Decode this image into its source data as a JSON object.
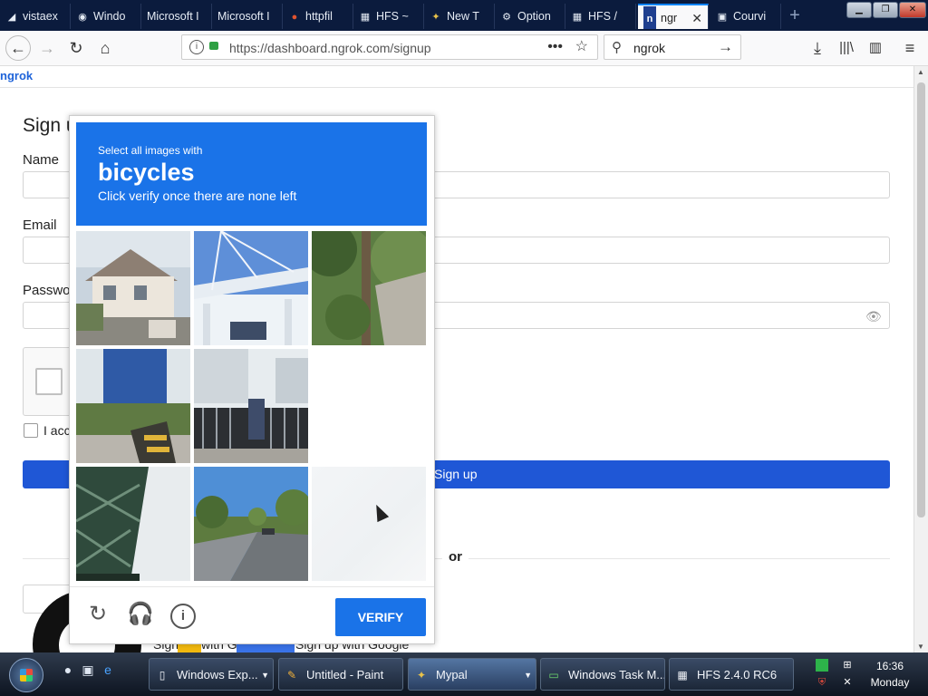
{
  "tabs": [
    {
      "label": "vistaex",
      "icon": "◢"
    },
    {
      "label": "Windo",
      "icon": "◉"
    },
    {
      "label": "Microsoft I",
      "icon": ""
    },
    {
      "label": "Microsoft I",
      "icon": ""
    },
    {
      "label": "httpfil",
      "icon": "●"
    },
    {
      "label": "HFS ~",
      "icon": "▦"
    },
    {
      "label": "New T",
      "icon": "✦"
    },
    {
      "label": "Option",
      "icon": "⚙"
    },
    {
      "label": "HFS /",
      "icon": "▦"
    },
    {
      "label": "ngr",
      "icon": "n"
    },
    {
      "label": "Courvi",
      "icon": "▣"
    }
  ],
  "browser": {
    "url": "https://dashboard.ngrok.com/signup",
    "search_value": "ngrok"
  },
  "page": {
    "brand": "ngrok",
    "heading": "Sign u",
    "name_label": "Name",
    "email_label": "Email",
    "password_label": "Passwor",
    "terms_label": "I acc",
    "signup_button": "Sign up",
    "or_text": "or",
    "github_partial": "Sign",
    "github_partial2": "with G",
    "google_button": "Sign up with Google"
  },
  "captcha": {
    "instruction_1": "Select all images with",
    "instruction_2": "bicycles",
    "instruction_3": "Click verify once there are none left",
    "verify_button": "VERIFY",
    "tiles": [
      {
        "state": "image",
        "subject": "house"
      },
      {
        "state": "image",
        "subject": "bridge"
      },
      {
        "state": "image",
        "subject": "trees"
      },
      {
        "state": "image",
        "subject": "fence"
      },
      {
        "state": "image",
        "subject": "gate"
      },
      {
        "state": "empty",
        "subject": ""
      },
      {
        "state": "image",
        "subject": "bridge-underside"
      },
      {
        "state": "image",
        "subject": "road"
      },
      {
        "state": "faded",
        "subject": ""
      }
    ]
  },
  "taskbar": {
    "buttons": [
      {
        "label": "Windows Exp...",
        "icon": "▯",
        "dropdown": true
      },
      {
        "label": "Untitled - Paint",
        "icon": "✎",
        "dropdown": false
      },
      {
        "label": "Mypal",
        "icon": "✦",
        "dropdown": true,
        "active": true
      },
      {
        "label": "Windows Task M...",
        "icon": "▭",
        "dropdown": false
      },
      {
        "label": "HFS 2.4.0 RC6",
        "icon": "▦",
        "dropdown": false
      }
    ],
    "time": "16:36",
    "day": "Monday"
  }
}
